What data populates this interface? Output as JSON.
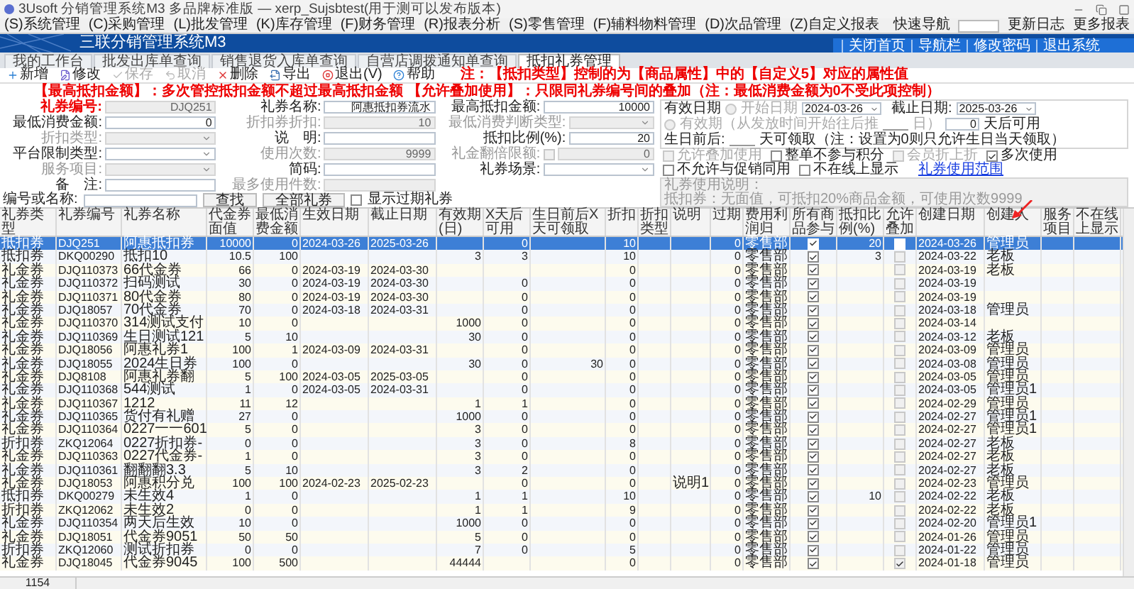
{
  "window": {
    "title": "3Usoft 分销管理系统M3 多品牌标准版 — xerp_Sujsbtest(用于测可以发布版本)"
  },
  "menu": {
    "items": [
      "(S)系统管理",
      "(C)采购管理",
      "(L)批发管理",
      "(K)库存管理",
      "(F)财务管理",
      "(R)报表分析",
      "(S)零售管理",
      "(F)辅料物料管理",
      "(D)次品管理",
      "(Z)自定义报表"
    ],
    "quick_nav_label": "快速导航",
    "links": [
      "更新日志",
      "更多报表"
    ]
  },
  "banner": {
    "title": "三联分销管理系统M3",
    "links": [
      "关闭首页",
      "导航栏",
      "修改密码",
      "退出系统"
    ]
  },
  "tabs": [
    {
      "label": "我的工作台",
      "selected": false
    },
    {
      "label": "批发出库单查询",
      "selected": false
    },
    {
      "label": "销售退货入库单查询",
      "selected": false
    },
    {
      "label": "自营店调拨通知单查询",
      "selected": false
    },
    {
      "label": "抵扣礼券管理",
      "selected": true
    }
  ],
  "toolbar": [
    {
      "label": "新增",
      "disabled": false
    },
    {
      "label": "修改",
      "disabled": false
    },
    {
      "label": "保存",
      "disabled": true
    },
    {
      "label": "取消",
      "disabled": true
    },
    {
      "label": "删除",
      "disabled": false
    },
    {
      "label": "导出",
      "disabled": false
    },
    {
      "label": "退出(V)",
      "disabled": false
    },
    {
      "label": "帮助",
      "disabled": false
    }
  ],
  "notes": [
    "注：【抵扣类型】控制的为【商品属性】中的【自定义5】对应的属性值",
    "【最高抵扣金额】：多次管控抵扣金额不超过最高抵扣金额 【允许叠加使用】：只限同礼券编号间的叠加（注：最低消费金额为0不受此项控制）"
  ],
  "form": {
    "fields": [
      {
        "label": "礼券编号:",
        "value": "DJQ251",
        "kind": "text",
        "disabled": true,
        "required": true
      },
      {
        "label": "礼券名称:",
        "value": "阿惠抵扣券流水",
        "kind": "text",
        "disabled": false,
        "required": false
      },
      {
        "label": "最高抵扣金额:",
        "value": "10000",
        "kind": "text",
        "disabled": false,
        "required": false
      },
      {
        "label": "最低消费金额:",
        "value": "0",
        "kind": "text",
        "disabled": false,
        "required": false
      },
      {
        "label": "折扣券折扣:",
        "value": "10",
        "kind": "text",
        "disabled": true,
        "required": false
      },
      {
        "label": "最低消费判断类型:",
        "kind": "select",
        "disabled": true,
        "required": false
      },
      {
        "label": "折扣类型:",
        "kind": "select",
        "disabled": true,
        "required": false
      },
      {
        "label": "说　明:",
        "kind": "text",
        "disabled": false,
        "required": false
      },
      {
        "label": "抵扣比例(%):",
        "value": "20",
        "kind": "text",
        "disabled": false,
        "required": false
      },
      {
        "label": "平台限制类型:",
        "kind": "select",
        "disabled": false,
        "required": false
      },
      {
        "label": "使用次数:",
        "value": "9999",
        "kind": "text",
        "disabled": true,
        "required": false
      },
      {
        "label": "礼金翻倍限额:",
        "value": "0",
        "kind": "check-text",
        "checked": false,
        "disabled": true,
        "required": false
      },
      {
        "label": "服务项目:",
        "kind": "select",
        "disabled": true,
        "required": false
      },
      {
        "label": "简码:",
        "kind": "text",
        "disabled": false,
        "required": false
      },
      {
        "label": "礼券场景:",
        "kind": "select",
        "disabled": false,
        "required": false
      },
      {
        "label": "备　注:",
        "kind": "text",
        "disabled": false,
        "required": false
      },
      {
        "label": "最多使用件数:",
        "kind": "text",
        "disabled": true,
        "required": false
      }
    ],
    "search": {
      "label": "编号或名称:",
      "buttons": [
        "查找",
        "全部礼券"
      ],
      "show_expired": {
        "label": "显示过期礼券",
        "checked": false
      }
    },
    "validity": {
      "legend": "有效日期",
      "start_radio": {
        "label": "开始日期",
        "selected": false,
        "disabled": true
      },
      "start_date": "2024-03-26",
      "end_label": "截止日期:",
      "end_date": "2025-03-26",
      "period_radio": {
        "label": "有效期（从发放时间开始往后推",
        "selected": false,
        "disabled": true
      },
      "period_suffix": "日）",
      "delay_value": "0",
      "delay_suffix": "天后可用",
      "birthday_label": "生日前后:",
      "birthday_note": "天可领取（注：设置为0则只允许生日当天领取）"
    },
    "options": [
      {
        "label": "允许叠加使用",
        "checked": false,
        "disabled": true
      },
      {
        "label": "整单不参与积分",
        "checked": false,
        "disabled": false
      },
      {
        "label": "会员折上折",
        "checked": false,
        "disabled": true
      },
      {
        "label": "多次使用",
        "checked": true,
        "disabled": false
      },
      {
        "label": "不允许与促销同用",
        "checked": false,
        "disabled": false
      },
      {
        "label": "不在线上显示",
        "checked": false,
        "disabled": false
      }
    ],
    "scope_link": "礼券使用范围",
    "description": {
      "title": "礼券使用说明：",
      "body": "抵扣券：无面值，可抵扣20%商品金额，可使用次数9999"
    }
  },
  "table": {
    "columns": [
      {
        "label": "礼券类型",
        "kind": "text"
      },
      {
        "label": "礼券编号",
        "kind": "code"
      },
      {
        "label": "礼券名称",
        "kind": "text"
      },
      {
        "label": "代金券面值",
        "kind": "num"
      },
      {
        "label": "最低消费金额",
        "kind": "num"
      },
      {
        "label": "生效日期",
        "kind": "code"
      },
      {
        "label": "截止日期",
        "kind": "code"
      },
      {
        "label": "有效期(日)",
        "kind": "num"
      },
      {
        "label": "X天后可用",
        "kind": "num"
      },
      {
        "label": "生日前后X天可领取",
        "kind": "num"
      },
      {
        "label": "折扣",
        "kind": "num"
      },
      {
        "label": "折扣类型",
        "kind": "text"
      },
      {
        "label": "说明",
        "kind": "text"
      },
      {
        "label": "过期",
        "kind": "num"
      },
      {
        "label": "费用利润归",
        "kind": "text"
      },
      {
        "label": "所有商品参与",
        "kind": "check"
      },
      {
        "label": "抵扣比例(%)",
        "kind": "num"
      },
      {
        "label": "允许叠加",
        "kind": "check"
      },
      {
        "label": "创建日期",
        "kind": "code"
      },
      {
        "label": "创建人",
        "kind": "text"
      },
      {
        "label": "服务项目",
        "kind": "text"
      },
      {
        "label": "不在线上显示",
        "kind": "text"
      }
    ],
    "rows": [
      {
        "selected": true,
        "cells": [
          "抵扣券",
          "DJQ251",
          "阿惠抵扣券",
          "10000",
          "0",
          "2024-03-26",
          "2025-03-26",
          null,
          "0",
          null,
          "10",
          null,
          null,
          "0",
          "零售部",
          true,
          "20",
          false,
          "2024-03-26",
          "管理员",
          null,
          null
        ]
      },
      {
        "selected": false,
        "cells": [
          "抵扣券",
          "DKQ00290",
          "抵扣10",
          "10.5",
          "100",
          null,
          null,
          "3",
          "3",
          null,
          "10",
          null,
          null,
          "0",
          "零售部",
          true,
          "3",
          false,
          "2024-03-22",
          "老板",
          null,
          null
        ]
      },
      {
        "selected": false,
        "cells": [
          "礼金券",
          "DJQ110373",
          "66代金券",
          "66",
          "0",
          "2024-03-19",
          "2024-03-30",
          null,
          null,
          null,
          "0",
          null,
          null,
          "0",
          "零售部",
          true,
          null,
          false,
          "2024-03-19",
          "老板",
          null,
          null
        ]
      },
      {
        "selected": false,
        "cells": [
          "礼金券",
          "DJQ110372",
          "扫码测试",
          "30",
          "0",
          "2024-03-19",
          "2024-03-30",
          null,
          "0",
          null,
          "0",
          null,
          null,
          "0",
          "零售部",
          true,
          null,
          false,
          "2024-03-19",
          null,
          null,
          null
        ]
      },
      {
        "selected": false,
        "cells": [
          "礼金券",
          "DJQ110371",
          "80代金券",
          "80",
          "0",
          "2024-03-19",
          "2024-03-30",
          null,
          "0",
          null,
          "0",
          null,
          null,
          "0",
          "零售部",
          true,
          null,
          false,
          "2024-03-19",
          null,
          null,
          null
        ]
      },
      {
        "selected": false,
        "cells": [
          "礼金券",
          "DJQ18057",
          "70代金券",
          "70",
          "0",
          "2024-03-18",
          "2024-03-31",
          null,
          "0",
          null,
          "0",
          null,
          null,
          "0",
          "零售部",
          true,
          null,
          false,
          "2024-03-18",
          "管理员",
          null,
          null
        ]
      },
      {
        "selected": false,
        "cells": [
          "礼金券",
          "DJQ110370",
          "314测试支付",
          "10",
          "0",
          null,
          null,
          "1000",
          "0",
          null,
          "0",
          null,
          null,
          "0",
          "零售部",
          true,
          null,
          false,
          "2024-03-14",
          null,
          null,
          null
        ]
      },
      {
        "selected": false,
        "cells": [
          "礼金券",
          "DJQ110369",
          "生日测试121",
          "5",
          "10",
          null,
          null,
          "30",
          "0",
          null,
          "0",
          null,
          null,
          "0",
          "零售部",
          true,
          null,
          false,
          "2024-03-12",
          "老板",
          null,
          null
        ]
      },
      {
        "selected": false,
        "cells": [
          "礼金券",
          "DJQ18056",
          "阿惠礼券1",
          "100",
          "1",
          "2024-03-09",
          "2024-03-31",
          null,
          "0",
          null,
          "0",
          null,
          null,
          "0",
          "零售部",
          true,
          null,
          false,
          "2024-03-09",
          "管理员",
          null,
          null
        ]
      },
      {
        "selected": false,
        "cells": [
          "礼金券",
          "DJQ18055",
          "2024生日券",
          "100",
          "0",
          null,
          null,
          "30",
          "0",
          "30",
          "0",
          null,
          null,
          "0",
          "零售部",
          true,
          null,
          false,
          "2024-03-08",
          "管理员",
          null,
          null
        ]
      },
      {
        "selected": false,
        "cells": [
          "礼金券",
          "DJQ8108",
          "阿惠礼券翻",
          "5",
          "100",
          "2024-03-05",
          "2025-03-05",
          null,
          "0",
          null,
          "0",
          null,
          null,
          "0",
          "零售部",
          true,
          null,
          false,
          "2024-03-05",
          "管理员",
          null,
          null
        ]
      },
      {
        "selected": false,
        "cells": [
          "礼金券",
          "DJQ110368",
          "544测试",
          "1",
          "0",
          "2024-03-05",
          "2024-03-31",
          null,
          "0",
          null,
          "0",
          null,
          null,
          "0",
          "零售部",
          true,
          null,
          false,
          "2024-03-05",
          "管理员1",
          null,
          null
        ]
      },
      {
        "selected": false,
        "cells": [
          "礼金券",
          "DJQ110367",
          "1212",
          "11",
          "12",
          null,
          null,
          "1",
          "1",
          null,
          "0",
          null,
          null,
          "0",
          "零售部",
          true,
          null,
          false,
          "2024-02-29",
          "管理员",
          null,
          null
        ]
      },
      {
        "selected": false,
        "cells": [
          "礼金券",
          "DJQ110365",
          "货付有礼赠",
          "27",
          "0",
          null,
          null,
          "1000",
          "0",
          null,
          "0",
          null,
          null,
          "0",
          "零售部",
          true,
          null,
          false,
          "2024-02-27",
          "管理员1",
          null,
          null
        ]
      },
      {
        "selected": false,
        "cells": [
          "礼金券",
          "DJQ110364",
          "0227一一601",
          "5",
          "0",
          null,
          null,
          "3",
          "0",
          null,
          "0",
          null,
          null,
          "0",
          "零售部",
          true,
          null,
          false,
          "2024-02-27",
          "管理员1",
          null,
          null
        ]
      },
      {
        "selected": false,
        "cells": [
          "折扣券",
          "ZKQ12064",
          "0227折扣券-",
          "0",
          "0",
          null,
          null,
          "3",
          "0",
          null,
          "8",
          null,
          null,
          "0",
          "零售部",
          true,
          null,
          false,
          "2024-02-27",
          "老板",
          null,
          null
        ]
      },
      {
        "selected": false,
        "cells": [
          "礼金券",
          "DJQ110363",
          "0227代金券-",
          "1",
          "0",
          null,
          null,
          "3",
          "0",
          null,
          "0",
          null,
          null,
          "0",
          "零售部",
          true,
          null,
          false,
          "2024-02-27",
          "老板",
          null,
          null
        ]
      },
      {
        "selected": false,
        "cells": [
          "礼金券",
          "DJQ110361",
          "翻翻翻3.3",
          "5",
          "10",
          null,
          null,
          "3",
          "2",
          null,
          "0",
          null,
          null,
          "0",
          "零售部",
          true,
          null,
          false,
          "2024-02-27",
          "老板",
          null,
          null
        ]
      },
      {
        "selected": false,
        "cells": [
          "礼金券",
          "DJQ18053",
          "阿惠积分兑",
          "100",
          "100",
          "2024-02-23",
          "2025-02-23",
          null,
          "0",
          null,
          "0",
          null,
          "说明1",
          "0",
          "零售部",
          true,
          null,
          false,
          "2024-02-23",
          "管理员",
          null,
          null
        ]
      },
      {
        "selected": false,
        "cells": [
          "抵扣券",
          "DKQ00279",
          "未生效4",
          "1",
          "0",
          null,
          null,
          "1",
          "1",
          null,
          "10",
          null,
          null,
          "0",
          "零售部",
          true,
          "10",
          false,
          "2024-02-22",
          "老板",
          null,
          null
        ]
      },
      {
        "selected": false,
        "cells": [
          "折扣券",
          "ZKQ12062",
          "未生效2",
          "0",
          "0",
          null,
          null,
          "1",
          "1",
          null,
          "9",
          null,
          null,
          "0",
          "零售部",
          true,
          null,
          false,
          "2024-02-22",
          "老板",
          null,
          null
        ]
      },
      {
        "selected": false,
        "cells": [
          "礼金券",
          "DJQ110354",
          "两天后生效",
          "10",
          "0",
          null,
          null,
          "1000",
          "0",
          null,
          "0",
          null,
          null,
          "0",
          "零售部",
          true,
          null,
          false,
          "2024-02-20",
          "管理员1",
          null,
          null
        ]
      },
      {
        "selected": false,
        "cells": [
          "礼金券",
          "DJQ18051",
          "代金券9051",
          "50",
          "50",
          null,
          null,
          "5",
          "0",
          null,
          "0",
          null,
          null,
          "0",
          "零售部",
          true,
          null,
          false,
          "2024-01-26",
          "管理员",
          null,
          null
        ]
      },
      {
        "selected": false,
        "cells": [
          "折扣券",
          "ZKQ12060",
          "测试折扣券",
          "0",
          "0",
          null,
          null,
          "7",
          "0",
          null,
          "5",
          null,
          null,
          "0",
          "零售部",
          true,
          null,
          false,
          "2024-01-22",
          "管理员",
          null,
          null
        ]
      },
      {
        "selected": false,
        "cells": [
          "礼金券",
          "DJQ18045",
          "代金券9045",
          "100",
          "500",
          null,
          null,
          "44444",
          null,
          null,
          "0",
          null,
          null,
          "0",
          "零售部",
          true,
          null,
          true,
          "2024-01-18",
          "管理员",
          null,
          null
        ]
      }
    ]
  },
  "status_bar": {
    "count": "1154"
  }
}
